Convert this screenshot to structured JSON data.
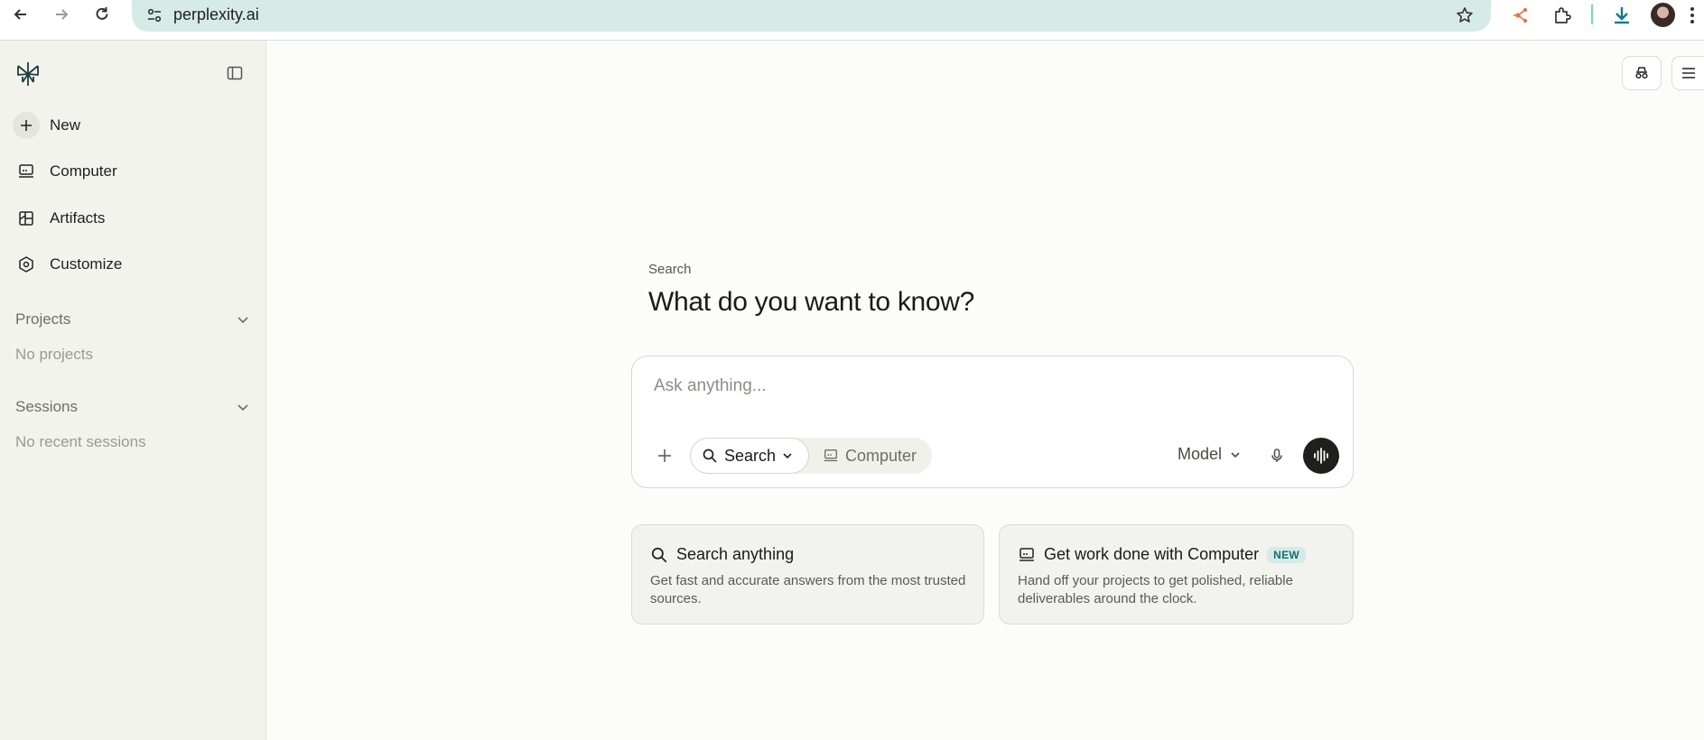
{
  "browser": {
    "url": "perplexity.ai"
  },
  "sidebar": {
    "items": [
      {
        "label": "New",
        "icon": "plus-icon"
      },
      {
        "label": "Computer",
        "icon": "computer-icon"
      },
      {
        "label": "Artifacts",
        "icon": "artifacts-icon"
      },
      {
        "label": "Customize",
        "icon": "customize-icon"
      }
    ],
    "projects": {
      "title": "Projects",
      "empty": "No projects"
    },
    "sessions": {
      "title": "Sessions",
      "empty": "No recent sessions"
    }
  },
  "main": {
    "eyebrow": "Search",
    "headline": "What do you want to know?",
    "composer": {
      "placeholder": "Ask anything...",
      "modes": [
        {
          "label": "Search",
          "selected": true
        },
        {
          "label": "Computer",
          "selected": false
        }
      ],
      "model_label": "Model"
    },
    "cards": [
      {
        "title": "Search anything",
        "description": "Get fast and accurate answers from the most trusted sources."
      },
      {
        "title": "Get work done with Computer",
        "badge": "NEW",
        "description": "Hand off your projects to get polished, reliable deliverables around the clock."
      }
    ]
  },
  "colors": {
    "accent": "#1c6b70",
    "omnibox": "#d6ebe8",
    "sidebar": "#f3f3ee",
    "background": "#fcfcf9"
  }
}
